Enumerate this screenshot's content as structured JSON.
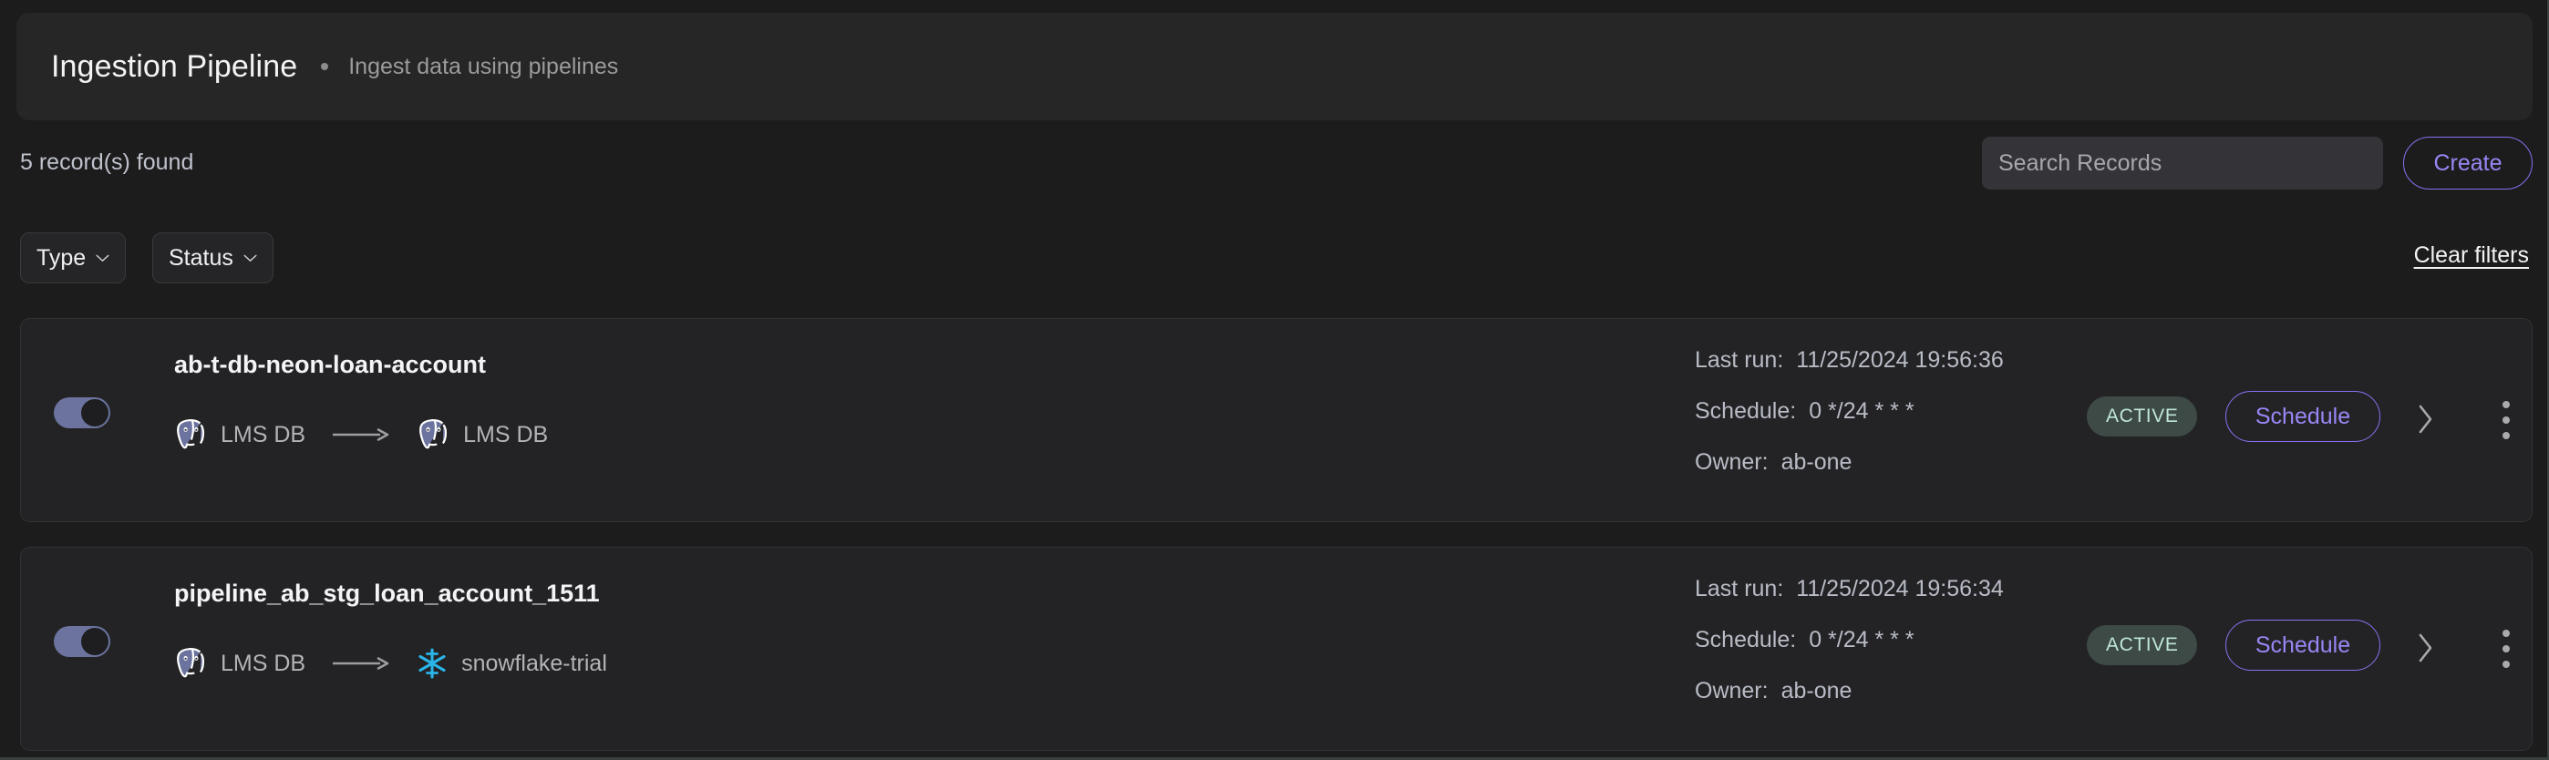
{
  "header": {
    "title": "Ingestion Pipeline",
    "separator_icon": "bullet-dot-icon",
    "subtitle": "Ingest data using pipelines"
  },
  "toolbar": {
    "record_count": "5 record(s) found",
    "search_placeholder": "Search Records",
    "search_value": "",
    "create_label": "Create"
  },
  "filters": {
    "type_label": "Type",
    "status_label": "Status",
    "clear_label": "Clear filters",
    "chevron_icon": "chevron-down-icon"
  },
  "colors": {
    "accent_purple": "#8b6ff0",
    "accent_purple_text": "#9a86f5",
    "toggle_on": "#6b739e",
    "badge_bg": "#3e4a46",
    "badge_text": "#bfe6d8",
    "postgres": "#6b739e",
    "snowflake": "#29b5e8",
    "page_bg": "#1c1c1c",
    "card_bg": "#232325",
    "header_bg": "#262626"
  },
  "labels": {
    "last_run_key": "Last run:",
    "schedule_key": "Schedule:",
    "owner_key": "Owner:",
    "schedule_button": "Schedule",
    "expand_icon": "chevron-right-icon",
    "more_icon": "kebab-menu-icon",
    "arrow_icon": "arrow-right-icon",
    "toggle_icon": "toggle-switch-on"
  },
  "pipelines": [
    {
      "name": "ab-t-db-neon-loan-account",
      "enabled": true,
      "source": {
        "label": "LMS DB",
        "icon": "postgresql-icon"
      },
      "destination": {
        "label": "LMS DB",
        "icon": "postgresql-icon"
      },
      "last_run": "11/25/2024 19:56:36",
      "schedule": "0 */24 * * *",
      "owner": "ab-one",
      "status": "ACTIVE"
    },
    {
      "name": "pipeline_ab_stg_loan_account_1511",
      "enabled": true,
      "source": {
        "label": "LMS DB",
        "icon": "postgresql-icon"
      },
      "destination": {
        "label": "snowflake-trial",
        "icon": "snowflake-icon"
      },
      "last_run": "11/25/2024 19:56:34",
      "schedule": "0 */24 * * *",
      "owner": "ab-one",
      "status": "ACTIVE"
    }
  ]
}
